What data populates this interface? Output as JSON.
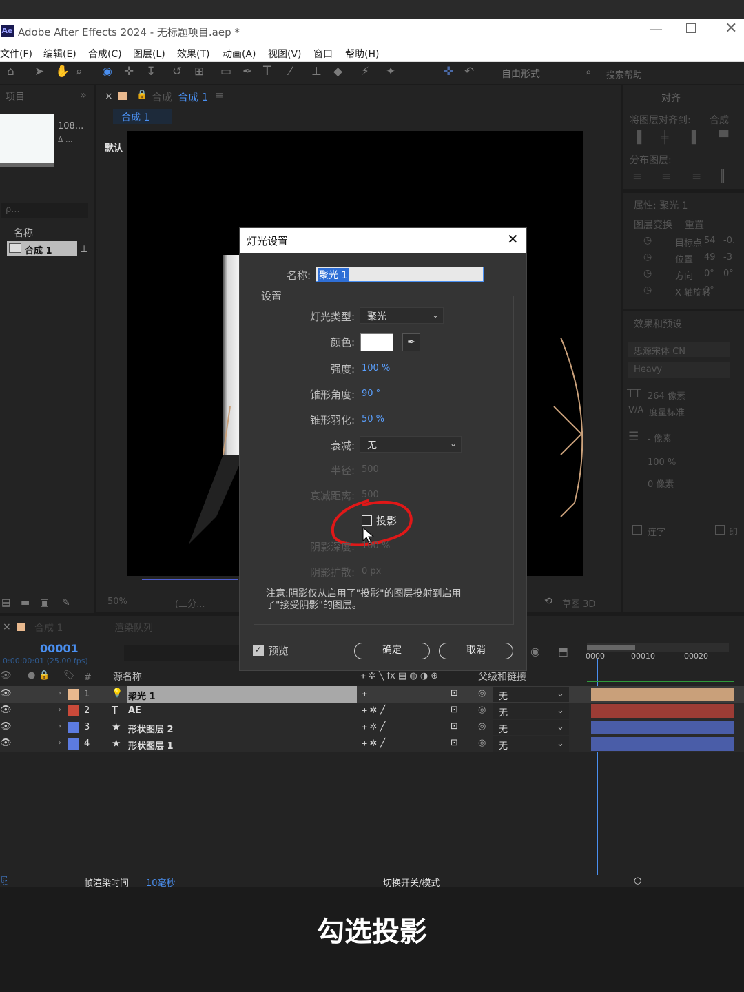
{
  "window": {
    "title": "Adobe After Effects 2024 - 无标题项目.aep *",
    "app_badge": "Ae"
  },
  "menu": [
    "文件(F)",
    "编辑(E)",
    "合成(C)",
    "图层(L)",
    "效果(T)",
    "动画(A)",
    "视图(V)",
    "窗口",
    "帮助(H)"
  ],
  "toolbar": {
    "mode": "自由形式",
    "search_placeholder": "搜索帮助"
  },
  "project": {
    "tab": "项目",
    "thumb_info": "108...",
    "thumb_sub": "Δ ...",
    "col_name": "名称",
    "item": "合成 1",
    "search": "ρ..."
  },
  "comp": {
    "tab_label": "合成",
    "tab_name": "合成 1",
    "breadcrumb": "合成 1",
    "renderer": "默认",
    "zoom": "50%",
    "resolution": "(二分...",
    "draft3d": "草图 3D"
  },
  "align": {
    "tab": "对齐",
    "align_to": "将图层对齐到:",
    "align_target": "合成",
    "distribute": "分布图层:"
  },
  "properties": {
    "tab": "属性: 聚光 1",
    "section": "图层变换",
    "reset": "重置",
    "rows": [
      {
        "label": "目标点",
        "value": "54"
      },
      {
        "label": "位置",
        "value": "49"
      },
      {
        "label": "方向",
        "value": "0°"
      },
      {
        "label": "X 轴旋转",
        "value": "0°"
      }
    ],
    "extra": [
      "-0.",
      "-3",
      "0°"
    ]
  },
  "effects": {
    "tab": "效果和预设",
    "font": "思源宋体 CN",
    "weight": "Heavy",
    "size": "264 像素",
    "tracking": "度量标准",
    "leading": "- 像素",
    "scale": "100 %",
    "baseline": "0 像素",
    "ligature": "连字",
    "other": "印"
  },
  "dialog": {
    "title": "灯光设置",
    "name_label": "名称:",
    "name_value": "聚光 1",
    "settings": "设置",
    "light_type_label": "灯光类型:",
    "light_type": "聚光",
    "color_label": "颜色:",
    "intensity_label": "强度:",
    "intensity": "100 %",
    "cone_angle_label": "锥形角度:",
    "cone_angle": "90 °",
    "cone_feather_label": "锥形羽化:",
    "cone_feather": "50 %",
    "falloff_label": "衰减:",
    "falloff": "无",
    "radius_label": "半径:",
    "radius": "500",
    "falloff_dist_label": "衰减距离:",
    "falloff_dist": "500",
    "cast_shadows": "投影",
    "shadow_darkness_label": "阴影深度:",
    "shadow_darkness": "100 %",
    "shadow_diffusion_label": "阴影扩散:",
    "shadow_diffusion": "0 px",
    "note": "注意:阴影仅从启用了\"投影\"的图层投射到启用了\"接受阴影\"的图层。",
    "preview": "预览",
    "ok": "确定",
    "cancel": "取消"
  },
  "timeline": {
    "tab": "合成 1",
    "render_queue": "渲染队列",
    "timecode": "00001",
    "timecode_sub": "0:00:00:01 (25.00 fps)",
    "col_source": "源名称",
    "col_parent": "父级和链接",
    "ruler": [
      "0000",
      "00010",
      "00020"
    ],
    "layers": [
      {
        "num": "1",
        "icon": "💡",
        "name": "聚光 1",
        "parent": "无",
        "color": "#e9b98e",
        "bar": "#c9a07a"
      },
      {
        "num": "2",
        "icon": "T",
        "name": "AE",
        "parent": "无",
        "color": "#c94a3a",
        "bar": "#9c3c35"
      },
      {
        "num": "3",
        "icon": "★",
        "name": "形状图层 2",
        "parent": "无",
        "color": "#5c7be0",
        "bar": "#4a5da8"
      },
      {
        "num": "4",
        "icon": "★",
        "name": "形状图层 1",
        "parent": "无",
        "color": "#5c7be0",
        "bar": "#4a5da8"
      }
    ],
    "status": "帧渲染时间",
    "status_value": "10毫秒",
    "toggle": "切换开关/模式"
  },
  "caption": "勾选投影"
}
